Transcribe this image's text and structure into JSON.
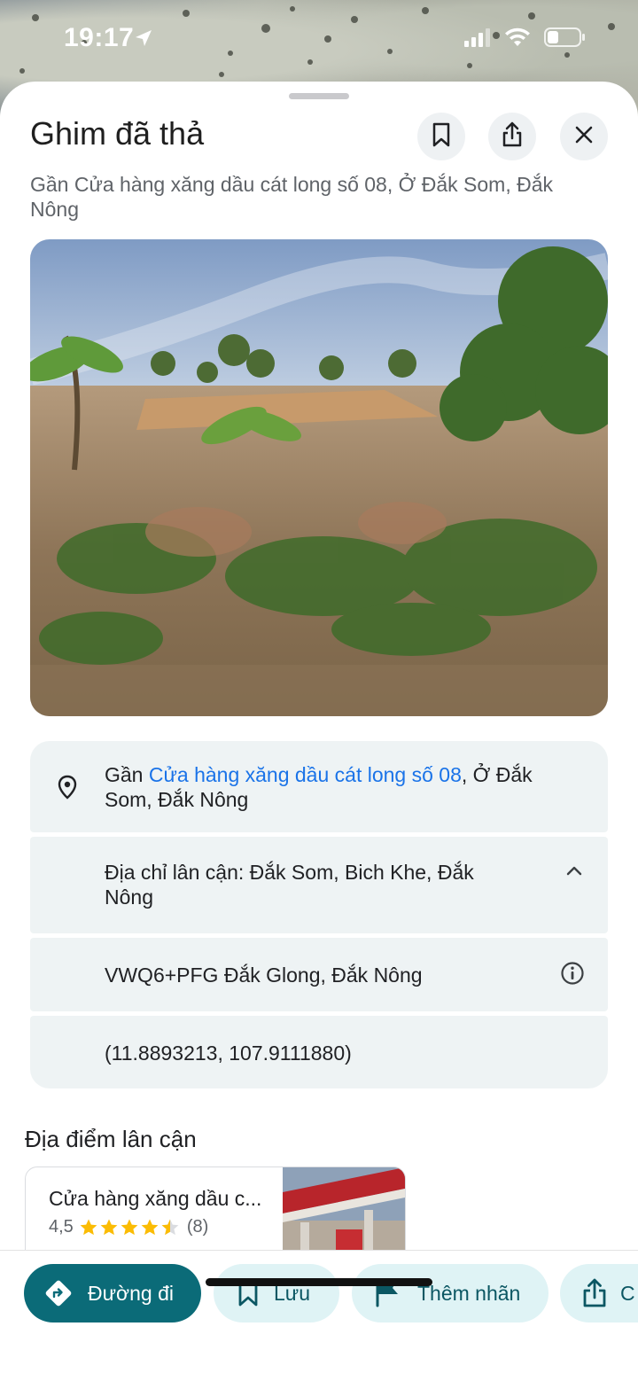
{
  "status_bar": {
    "time": "19:17"
  },
  "sheet": {
    "title": "Ghim đã thả",
    "subtitle": "Gần Cửa hàng xăng dầu cát long số 08, Ở Đắk Som, Đắk Nông"
  },
  "info": {
    "near_prefix": "Gần ",
    "near_link": "Cửa hàng xăng dầu cát long số 08",
    "near_suffix": ", Ở Đắk Som, Đắk Nông",
    "nearby_address": "Địa chỉ lân cận: Đắk Som, Bich Khe, Đắk Nông",
    "plus_code": "VWQ6+PFG Đắk Glong, Đắk Nông",
    "coordinates": "(11.8893213, 107.9111880)"
  },
  "nearby": {
    "heading": "Địa điểm lân cận",
    "items": [
      {
        "name": "Cửa hàng xăng dầu c...",
        "rating": "4,5",
        "stars": 4.5,
        "count": "(8)"
      }
    ]
  },
  "actions": {
    "directions": "Đường đi",
    "save": "Lưu",
    "label": "Thêm nhãn",
    "share": "C"
  },
  "icons": [
    "navigation-arrow-icon",
    "signal-icon",
    "wifi-icon",
    "battery-icon",
    "bookmark-icon",
    "share-icon",
    "close-icon",
    "pin-icon",
    "chevron-up-icon",
    "info-icon",
    "directions-icon",
    "flag-icon"
  ],
  "colors": {
    "link": "#1a73e8",
    "primary": "#0b6b78",
    "secondary_chip": "#dff3f5",
    "star": "#fbbc04"
  }
}
